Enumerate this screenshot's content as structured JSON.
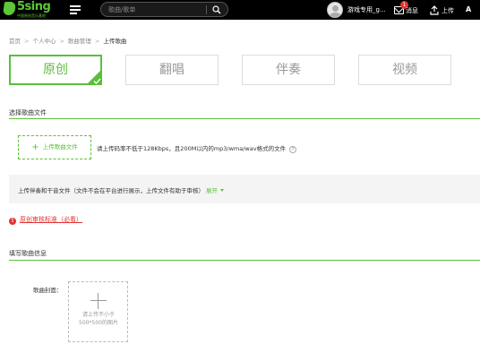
{
  "header": {
    "logo_text": "5sing",
    "logo_sub": "中国原创音乐基地",
    "search_placeholder": "歌曲/歌单",
    "username": "游戏专用_g...",
    "message_badge": "1",
    "message_label": "消息",
    "upload_label": "上传",
    "app_letter": "A"
  },
  "breadcrumb": [
    "首页",
    "个人中心",
    "歌曲管理",
    "上传歌曲"
  ],
  "tabs": [
    {
      "label": "原创",
      "active": true
    },
    {
      "label": "翻唱",
      "active": false
    },
    {
      "label": "伴奏",
      "active": false
    },
    {
      "label": "视频",
      "active": false
    }
  ],
  "file_section": {
    "title": "选择歌曲文件",
    "upload_button": "上传歌曲文件",
    "hint": "请上传码率不低于128Kbps，且200M以内的mp3/wma/wav格式的文件",
    "help": "?"
  },
  "extra": {
    "text": "上传伴奏和干音文件（文件不会在平台进行展示，上传文件有助于审核）",
    "expand": "展开"
  },
  "notice": {
    "icon": "!",
    "link": "原创审核标准（必看）"
  },
  "info_section": {
    "title": "填写歌曲信息",
    "cover_label": "歌曲封面：",
    "cover_hint_1": "请上传不小于",
    "cover_hint_2": "500*500的图片"
  },
  "colors": {
    "accent": "#5cbf3a",
    "danger": "#e23333",
    "topbar": "#000000"
  }
}
